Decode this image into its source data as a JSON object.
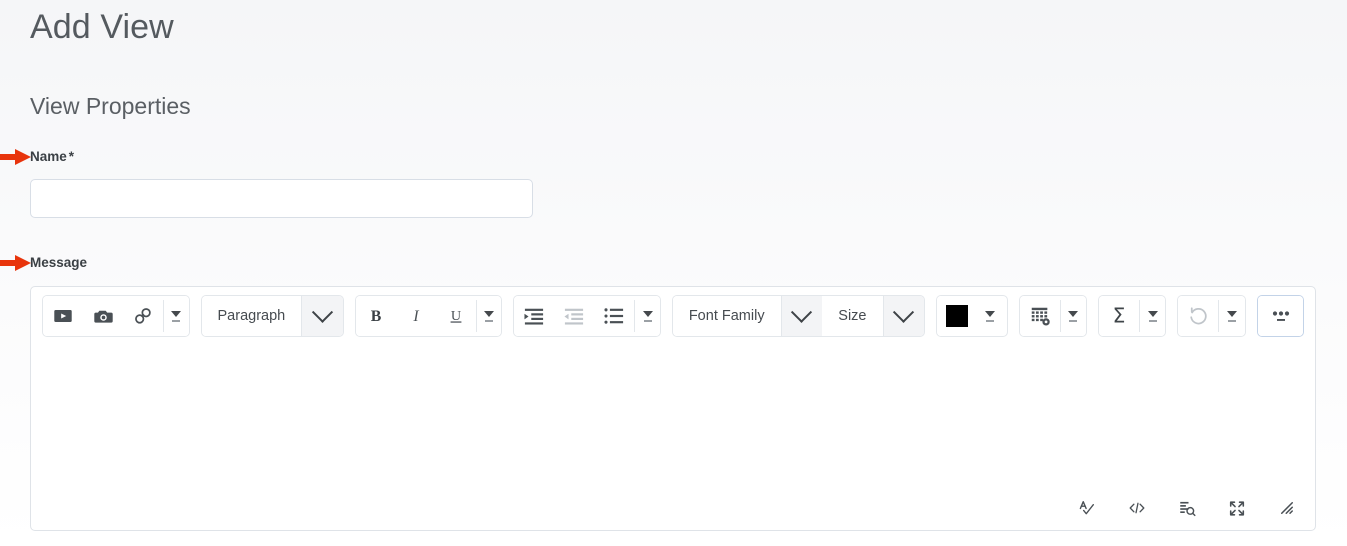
{
  "page": {
    "title": "Add View",
    "section_title": "View Properties"
  },
  "fields": {
    "name": {
      "label": "Name",
      "required_marker": "*",
      "value": "",
      "placeholder": ""
    },
    "message": {
      "label": "Message"
    }
  },
  "editor": {
    "toolbar": {
      "groups": [
        {
          "name": "insert",
          "buttons": [
            {
              "icon": "video-icon",
              "label": "Insert/edit media"
            },
            {
              "icon": "camera-icon",
              "label": "Record/upload media"
            },
            {
              "icon": "link-icon",
              "label": "Insert/edit link"
            }
          ],
          "overflow_caret": true
        },
        {
          "name": "block-format",
          "type": "select",
          "value": "Paragraph"
        },
        {
          "name": "text-style",
          "buttons": [
            {
              "icon": "bold-icon",
              "label": "Bold"
            },
            {
              "icon": "italic-icon",
              "label": "Italic"
            },
            {
              "icon": "underline-icon",
              "label": "Underline"
            }
          ],
          "overflow_caret": true
        },
        {
          "name": "alignment-lists",
          "buttons": [
            {
              "icon": "indent-icon",
              "label": "Increase indent",
              "disabled": false
            },
            {
              "icon": "outdent-icon",
              "label": "Decrease indent",
              "disabled": true
            },
            {
              "icon": "bullet-list-icon",
              "label": "Bulleted list",
              "disabled": false
            }
          ],
          "overflow_caret": true
        },
        {
          "name": "font",
          "type": "select-pair",
          "font_family_value": "Font Family",
          "size_value": "Size"
        },
        {
          "name": "text-color",
          "swatch_color": "#000000",
          "overflow_caret": true
        },
        {
          "name": "table",
          "buttons": [
            {
              "icon": "table-icon",
              "label": "Table"
            }
          ],
          "overflow_caret": true
        },
        {
          "name": "equation",
          "buttons": [
            {
              "icon": "sigma-icon",
              "label": "Insert equation"
            }
          ],
          "overflow_caret": true
        },
        {
          "name": "undo",
          "buttons": [
            {
              "icon": "undo-icon",
              "label": "Undo",
              "disabled": true
            }
          ],
          "overflow_caret": true
        },
        {
          "name": "more",
          "buttons": [
            {
              "icon": "ellipsis-icon",
              "label": "More options"
            }
          ],
          "focused": true
        }
      ]
    },
    "content": "",
    "status_bar": [
      {
        "icon": "spellcheck-icon",
        "label": "Check accessibility"
      },
      {
        "icon": "code-icon",
        "label": "HTML editor"
      },
      {
        "icon": "word-count-icon",
        "label": "Word count"
      },
      {
        "icon": "fullscreen-icon",
        "label": "Fullscreen"
      },
      {
        "icon": "resize-handle-icon",
        "label": "Resize"
      }
    ]
  },
  "annotations": {
    "arrow_color": "#e8340c",
    "arrows": [
      {
        "points_to": "name-label"
      },
      {
        "points_to": "message-label"
      }
    ]
  }
}
